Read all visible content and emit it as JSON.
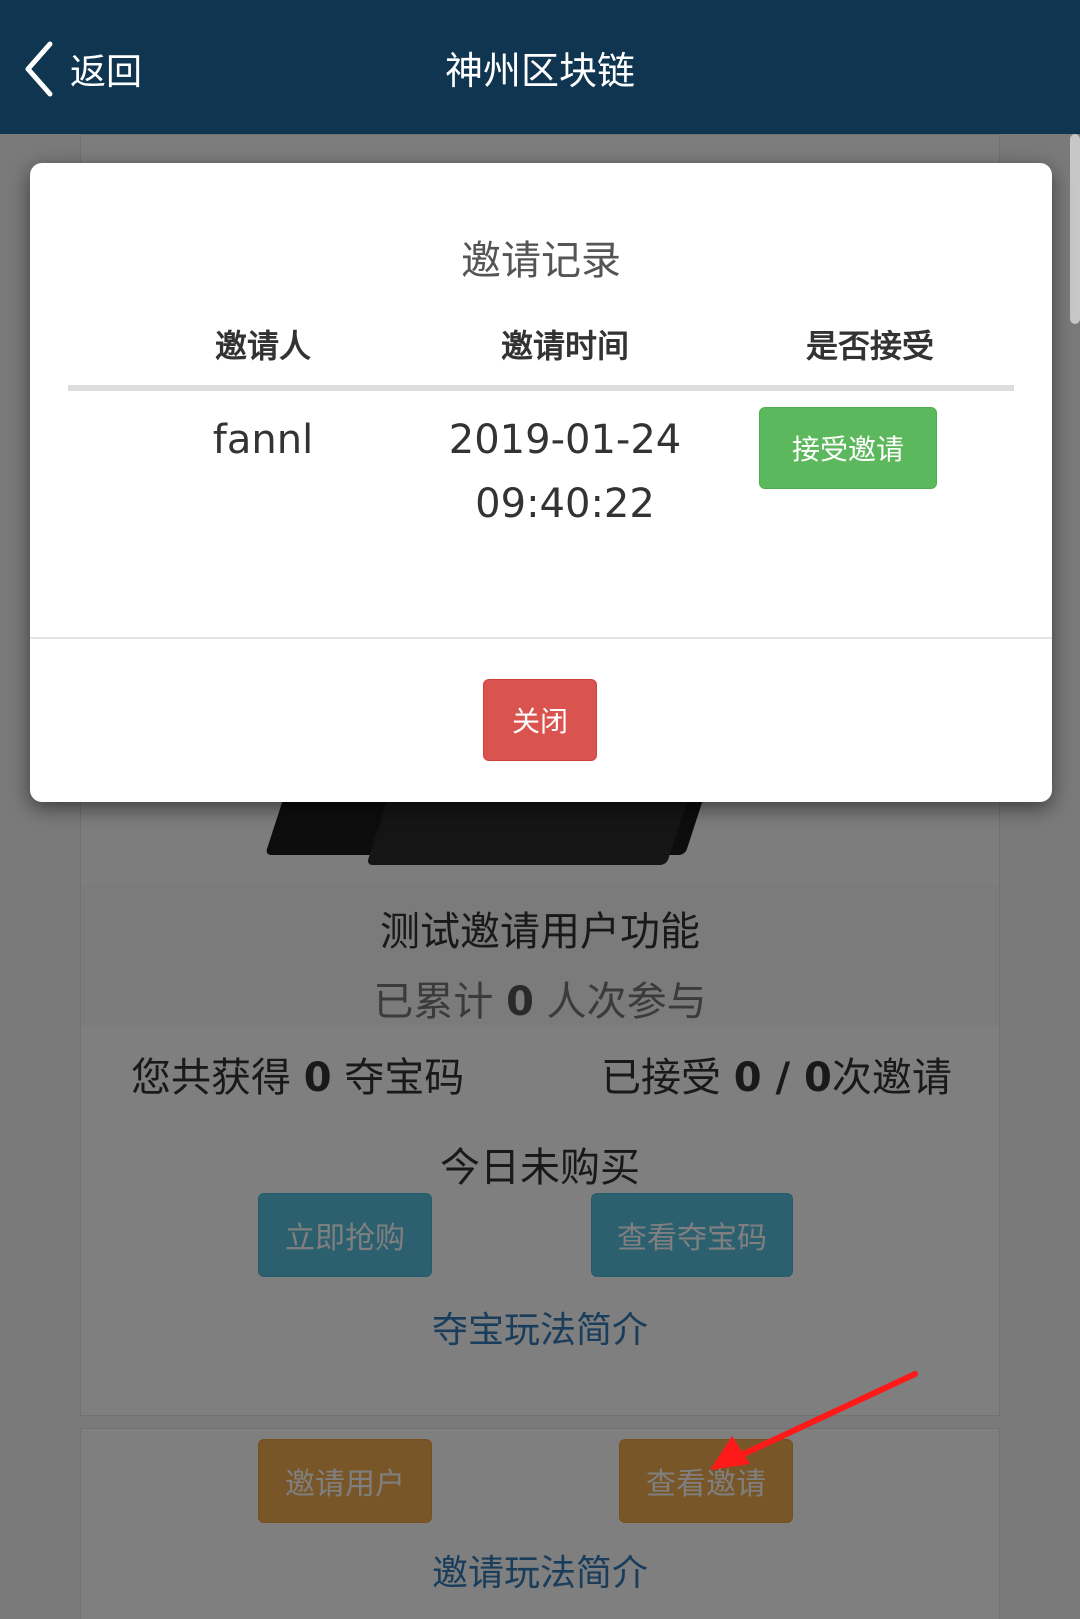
{
  "header": {
    "back_label": "返回",
    "title": "神州区块链"
  },
  "page": {
    "product_name": "测试邀请用户功能",
    "participants_prefix": "已累计 ",
    "participants_count": "0",
    "participants_suffix": " 人次参与",
    "codes_prefix": "您共获得 ",
    "codes_count": "0",
    "codes_suffix": " 夺宝码",
    "invites_prefix": "已接受 ",
    "invites_value": "0 / 0",
    "invites_suffix": "次邀请",
    "today_status": "今日未购买",
    "buy_now_label": "立即抢购",
    "view_codes_label": "查看夺宝码",
    "treasure_rules_link": "夺宝玩法简介",
    "invite_user_label": "邀请用户",
    "view_invites_label": "查看邀请",
    "invite_rules_link": "邀请玩法简介"
  },
  "modal": {
    "title": "邀请记录",
    "columns": [
      "邀请人",
      "邀请时间",
      "是否接受"
    ],
    "rows": [
      {
        "inviter": "fannl",
        "date": "2019-01-24",
        "time": "09:40:22",
        "action_label": "接受邀请"
      }
    ],
    "close_label": "关闭"
  },
  "colors": {
    "header_bg": "#0f3550",
    "accept": "#5cb85c",
    "close": "#d9534f",
    "info_button": "#5bc0de",
    "warning_button": "#f0ad4e",
    "link": "#337ab7",
    "annotation_arrow": "#ff1a1a"
  }
}
